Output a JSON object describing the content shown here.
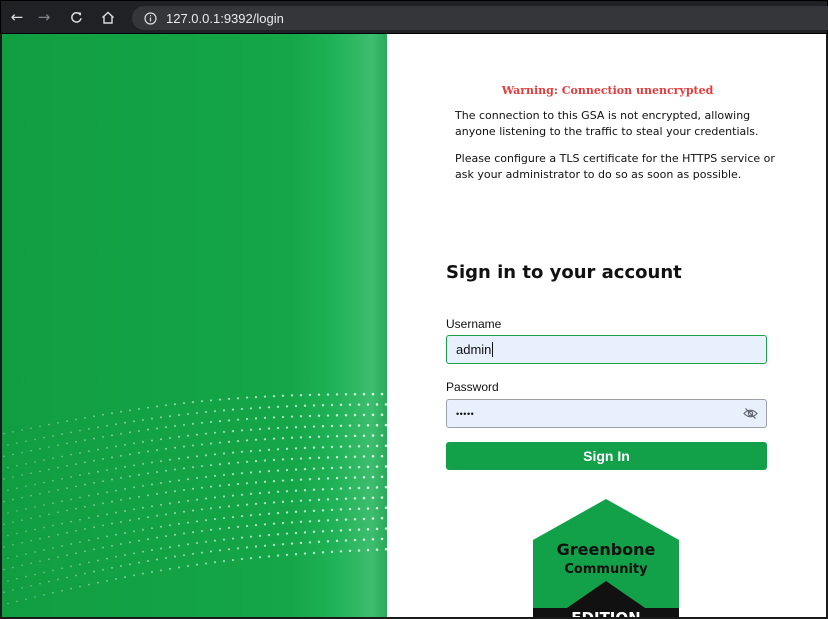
{
  "browser": {
    "back_icon": "arrow-left-icon",
    "forward_icon": "arrow-right-icon",
    "reload_icon": "reload-icon",
    "home_icon": "home-icon",
    "info_icon": "info-circle-icon",
    "url": "127.0.0.1:9392/login"
  },
  "warning": {
    "title": "Warning: Connection unencrypted",
    "paragraph1": "The connection to this GSA is not encrypted, allowing anyone listening to the traffic to steal your credentials.",
    "paragraph2": "Please configure a TLS certificate for the HTTPS service or ask your administrator to do so as soon as possible."
  },
  "login": {
    "heading": "Sign in to your account",
    "username_label": "Username",
    "username_value": "admin",
    "password_label": "Password",
    "password_value": "•••••",
    "eye_icon": "eye-off-icon",
    "signin_label": "Sign In"
  },
  "logo": {
    "line1": "Greenbone",
    "line2": "Community",
    "line3": "EDITION"
  },
  "colors": {
    "brand_green": "#12a049",
    "warning_red": "#e83a3a",
    "input_bg": "#e8f0fe"
  }
}
